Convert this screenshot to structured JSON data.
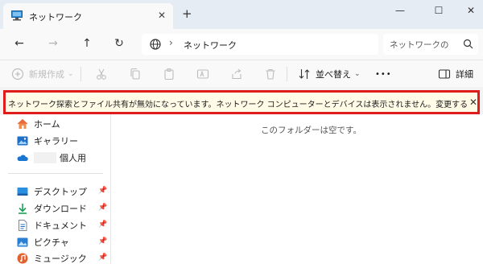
{
  "tab": {
    "title": "ネットワーク",
    "close": "✕",
    "new_tab": "+"
  },
  "window": {
    "minimize": "—",
    "maximize": "☐",
    "close": "✕"
  },
  "nav": {
    "back": "←",
    "forward": "→",
    "up": "↑",
    "refresh": "↻"
  },
  "address": {
    "chevron": "›",
    "location": "ネットワーク"
  },
  "search": {
    "placeholder": "ネットワークの"
  },
  "commands": {
    "new_label": "新規作成",
    "new_chevron": "⌄",
    "sort_label": "並べ替え",
    "sort_chevron": "⌄",
    "more": "•••",
    "details_label": "詳細"
  },
  "infobar": {
    "message": "ネットワーク探索とファイル共有が無効になっています。ネットワーク コンピューターとデバイスは表示されません。変更するにはクリックしてください...",
    "close": "✕"
  },
  "sidebar": {
    "items": [
      {
        "label": "ホーム"
      },
      {
        "label": "ギャラリー"
      },
      {
        "label": "個人用"
      },
      {
        "label": "デスクトップ"
      },
      {
        "label": "ダウンロード"
      },
      {
        "label": "ドキュメント"
      },
      {
        "label": "ピクチャ"
      },
      {
        "label": "ミュージック"
      }
    ],
    "pin": "📌"
  },
  "content": {
    "empty_message": "このフォルダーは空です。"
  },
  "colors": {
    "highlight_border": "#e01b1b",
    "infobar_bg": "#fffbe6",
    "accent": "#0067c0"
  }
}
